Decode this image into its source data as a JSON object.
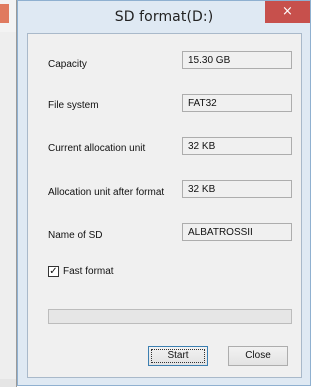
{
  "dialog": {
    "title": "SD format(D:)",
    "close_glyph": "×"
  },
  "fields": {
    "capacity": {
      "label": "Capacity",
      "value": "15.30 GB"
    },
    "file_system": {
      "label": "File system",
      "value": "FAT32"
    },
    "current_unit": {
      "label": "Current allocation unit",
      "value": "32 KB"
    },
    "unit_after": {
      "label": "Allocation unit after format",
      "value": "32 KB"
    },
    "name": {
      "label": "Name of SD",
      "value": "ALBATROSSII"
    }
  },
  "options": {
    "fast_format_label": "Fast format",
    "fast_format_checked": true,
    "check_glyph": "✓"
  },
  "progress": {
    "percent": 0
  },
  "buttons": {
    "start": "Start",
    "close": "Close"
  },
  "colors": {
    "frame": "#dfe9f3",
    "close_button": "#c7504c",
    "client": "#f0f0f0"
  }
}
